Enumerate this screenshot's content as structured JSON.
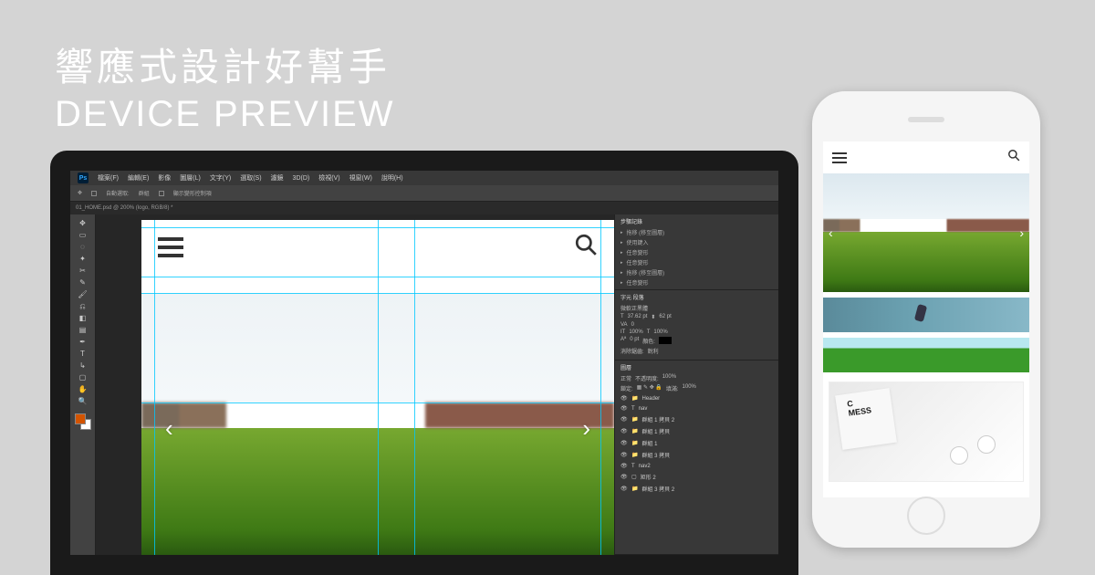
{
  "headline": {
    "title_zh": "響應式設計好幫手",
    "title_en": "DEVICE PREVIEW"
  },
  "photoshop": {
    "logo": "Ps",
    "menu": [
      "檔案(F)",
      "編輯(E)",
      "影像",
      "圖層(L)",
      "文字(Y)",
      "選取(S)",
      "濾鏡",
      "3D(D)",
      "檢視(V)",
      "視窗(W)",
      "說明(H)"
    ],
    "options": {
      "label1": "自動選取:",
      "value1": "群組",
      "label2": "顯示變形控制項"
    },
    "tab": "01_HOME.psd @ 200% (logo, RGB/8) *",
    "panels": {
      "history": {
        "title": "步驟記錄",
        "items": [
          "拖移 (移至圖層)",
          "使用鍵入",
          "任意變形",
          "任意變形",
          "拖移 (移至圖層)",
          "任意變形"
        ]
      },
      "character": {
        "title": "字元 段落",
        "font": "微軟正黑體",
        "size": "37.62 pt",
        "leading": "62 pt",
        "tracking": "0",
        "scale_v": "100%",
        "scale_h": "100%",
        "baseline": "0 pt",
        "color_label": "顏色:",
        "aa_label": "消除鋸齒:",
        "aa_value": "銳利"
      },
      "layers": {
        "title": "圖層",
        "blend": "正常",
        "opacity_label": "不透明度:",
        "opacity": "100%",
        "lock_label": "鎖定:",
        "fill_label": "填滿:",
        "fill": "100%",
        "items": [
          {
            "type": "group",
            "name": "Header"
          },
          {
            "type": "text",
            "name": "nav"
          },
          {
            "type": "group",
            "name": "群組 1 拷貝 2"
          },
          {
            "type": "group",
            "name": "群組 1 拷貝"
          },
          {
            "type": "group",
            "name": "群組 1"
          },
          {
            "type": "group",
            "name": "群組 3 拷貝"
          },
          {
            "type": "text",
            "name": "nav2"
          },
          {
            "type": "layer",
            "name": "矩形 2"
          },
          {
            "type": "group",
            "name": "群組 3 拷貝 2"
          }
        ]
      }
    },
    "canvas": {
      "arrow_left": "‹",
      "arrow_right": "›"
    }
  },
  "phone": {
    "arrow_left": "‹",
    "arrow_right": "›",
    "card_line1": "C",
    "card_line2": "MESS"
  }
}
